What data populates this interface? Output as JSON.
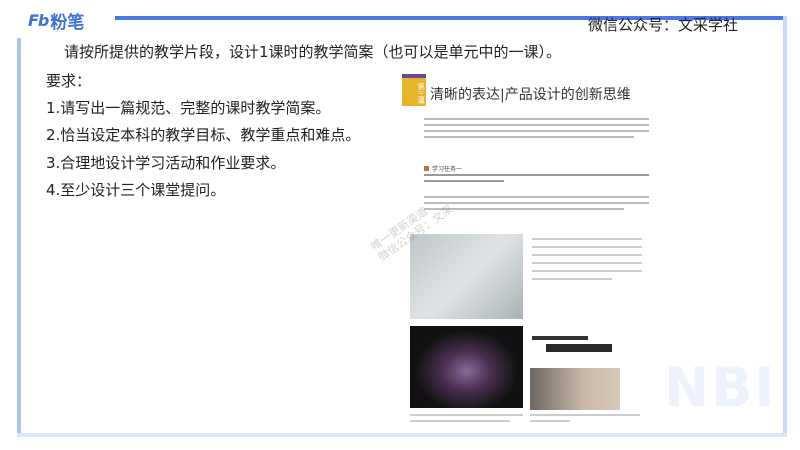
{
  "header": {
    "logo_text": "粉笔",
    "logo_mark": "Fb",
    "watermark": "微信公众号：文采学社"
  },
  "content": {
    "intro": "请按所提供的教学片段，设计1课时的教学简案（也可以是单元中的一课）。",
    "req_title": "要求：",
    "requirements": [
      "1.请写出一篇规范、完整的课时教学简案。",
      "2.恰当设定本科的教学目标、教学重点和难点。",
      "3.合理地设计学习活动和作业要求。",
      "4.至少设计三个课堂提问。"
    ]
  },
  "figure": {
    "badge": "第三课",
    "title": "清晰的表达|产品设计的创新思维",
    "task_heading": "学习任务一"
  },
  "overlay": {
    "diagonal_line1": "唯一更新渠道",
    "diagonal_line2": "微信公众号：文采",
    "corner_mark": "NBI"
  },
  "colors": {
    "accent": "#4a78e6"
  }
}
